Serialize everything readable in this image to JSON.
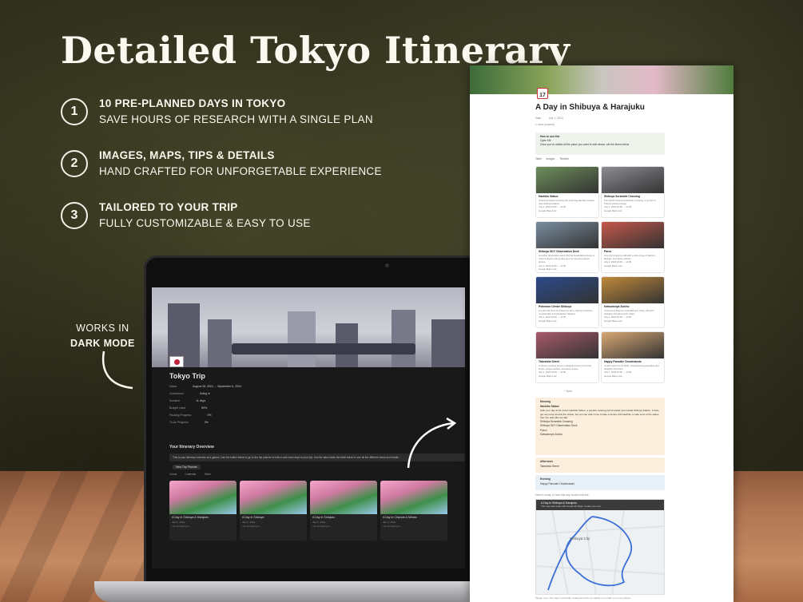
{
  "headline": "Detailed Tokyo Itinerary",
  "features": [
    {
      "num": "1",
      "title": "10 PRE-PLANNED DAYS IN TOKYO",
      "subtitle": "SAVE HOURS OF RESEARCH WITH A SINGLE PLAN"
    },
    {
      "num": "2",
      "title": "IMAGES, MAPS, TIPS & DETAILS",
      "subtitle": "HAND CRAFTED FOR UNFORGETABLE EXPERIENCE"
    },
    {
      "num": "3",
      "title": "TAILORED TO YOUR TRIP",
      "subtitle": "FULLY CUSTOMIZABLE & EASY TO USE"
    }
  ],
  "dark_note": {
    "line1": "WORKS IN",
    "line2": "DARK MODE"
  },
  "dark_page": {
    "title": "Tokyo Trip",
    "props": [
      {
        "k": "Dates",
        "v": "August 28, 2024 → September 6, 2024"
      },
      {
        "k": "Countdown",
        "v": "Going in"
      },
      {
        "k": "Duration",
        "v": "11 days"
      },
      {
        "k": "Budget Used",
        "v": "69%"
      },
      {
        "k": "Packing Progress",
        "v": "0%"
      },
      {
        "k": "To-do Progress",
        "v": "2%"
      }
    ],
    "section": "Your Itinerary Overview",
    "callout": "This is your itinerary overview at a glance. Use the button below to go to the trip planner to edit or add more days to your trip. Use the tabs inside the table below to see all the different views and details.",
    "button": "New Trip Planner",
    "tabs": [
      "Cards",
      "Calendar",
      "Table"
    ],
    "cards": [
      {
        "title": "A Day in Shibuya & Harajuku",
        "date": "July 1, 2024"
      },
      {
        "title": "A Day in Shibuya",
        "date": "July 2, 2024"
      },
      {
        "title": "A Day in Shinjuku",
        "date": "July 3, 2024"
      },
      {
        "title": "A Day in Chiyoda & Minato",
        "date": "July 4, 2024"
      }
    ],
    "card_sub": "You are going to:"
  },
  "doc": {
    "title": "A Day in Shibuya & Harajuku",
    "date_label": "Date",
    "date": "July 1, 2024",
    "more": "1 more property",
    "callout": {
      "title": "How to use this",
      "open": "Open Me",
      "body": "Once you've added all the place you want to visit above, set the times below"
    },
    "tabs": [
      "Table",
      "Images",
      "Timeline"
    ],
    "places": [
      {
        "name": "Hachiko Statue",
        "desc": "A beloved statue honoring the loyal dog Hachiko located near Shibuya Station.",
        "time": "July 1, 2024 10:00 → 11:00",
        "link": "Google Maps Link",
        "color": "#6d8f5a"
      },
      {
        "name": "Shibuya Scramble Crossing",
        "desc": "The world's busiest pedestrian crossing, a symbol of Tokyo's vibrant energy.",
        "time": "July 1, 2024 10:00 → 11:00",
        "link": "Google Maps Link",
        "color": "#8c8c94"
      },
      {
        "name": "Shibuya SKY Observation Deck",
        "desc": "A rooftop observation deck offering breathtaking views of Tokyo's skyline and perfect spot for stunning sunset photos.",
        "time": "July 1, 2024 10:00 → 11:00",
        "link": "Google Maps Link",
        "color": "#7a8ea0"
      },
      {
        "name": "Parco",
        "desc": "A trendy shopping mall with a wide range of fashion, lifestyle, and dining options.",
        "time": "July 1, 2024 10:00 → 11:00",
        "link": "Google Maps Link",
        "color": "#c5584a"
      },
      {
        "name": "Pokemon Center Shibuya",
        "desc": "A must-visit store for Pokemon fans, offering exclusive merchandise and interactive displays.",
        "time": "July 1, 2024 10:00 → 11:00",
        "link": "Google Maps Link",
        "color": "#2b4a8a"
      },
      {
        "name": "Katsudonya Zuicho",
        "desc": "A famous restaurant specializing in crispy, flavorful katsudon (breaded pork cutlet).",
        "time": "July 1, 2024 10:00 → 11:00",
        "link": "Google Maps Link",
        "color": "#c0893a"
      },
      {
        "name": "Takeshita Street",
        "desc": "A vibrant, bustling street in Harajuku known for trendy shops, unique fashion, and tasty crepes.",
        "time": "July 1, 2024 10:00 → 11:00",
        "link": "Google Maps Link",
        "color": "#a85a6a"
      },
      {
        "name": "Happy Pancake Omotesando",
        "desc": "A cafe known for its fluffy, mouthwatering pancakes and delightful brunches.",
        "time": "July 1, 2024 10:00 → 11:00",
        "link": "Google Maps Link",
        "color": "#d8a874"
      }
    ],
    "new_label": "+ New",
    "morning": {
      "label": "Morning",
      "items": [
        "Hachiko Statue",
        "Shibuya Scramble Crossing",
        "Shibuya SKY Observation Deck",
        "Parco",
        "Katsudonya Zuicho"
      ],
      "detail": "Start your day at the iconic Hachiko Statue, a popular meeting point located just outside Shibuya Station. It does get very busy around the statue, but you can wait in line to take a picture with Hachiko or take a pic of the statue from the side (like we did)."
    },
    "afternoon": {
      "label": "Afternoon",
      "items": [
        "Takeshita Street"
      ]
    },
    "evening": {
      "label": "Evening",
      "items": [
        "Happy Pancake Omotesando"
      ]
    },
    "map_intro": "Here's a map of how this day would look like.",
    "map_title": "A Day in Shibuya & Harajuku",
    "map_sub": "This map was made with Google My Maps. Create your own.",
    "map_city": "Shibuya City",
    "map_note": "Please note, this map is manually created and will not update if you add or remove places."
  }
}
